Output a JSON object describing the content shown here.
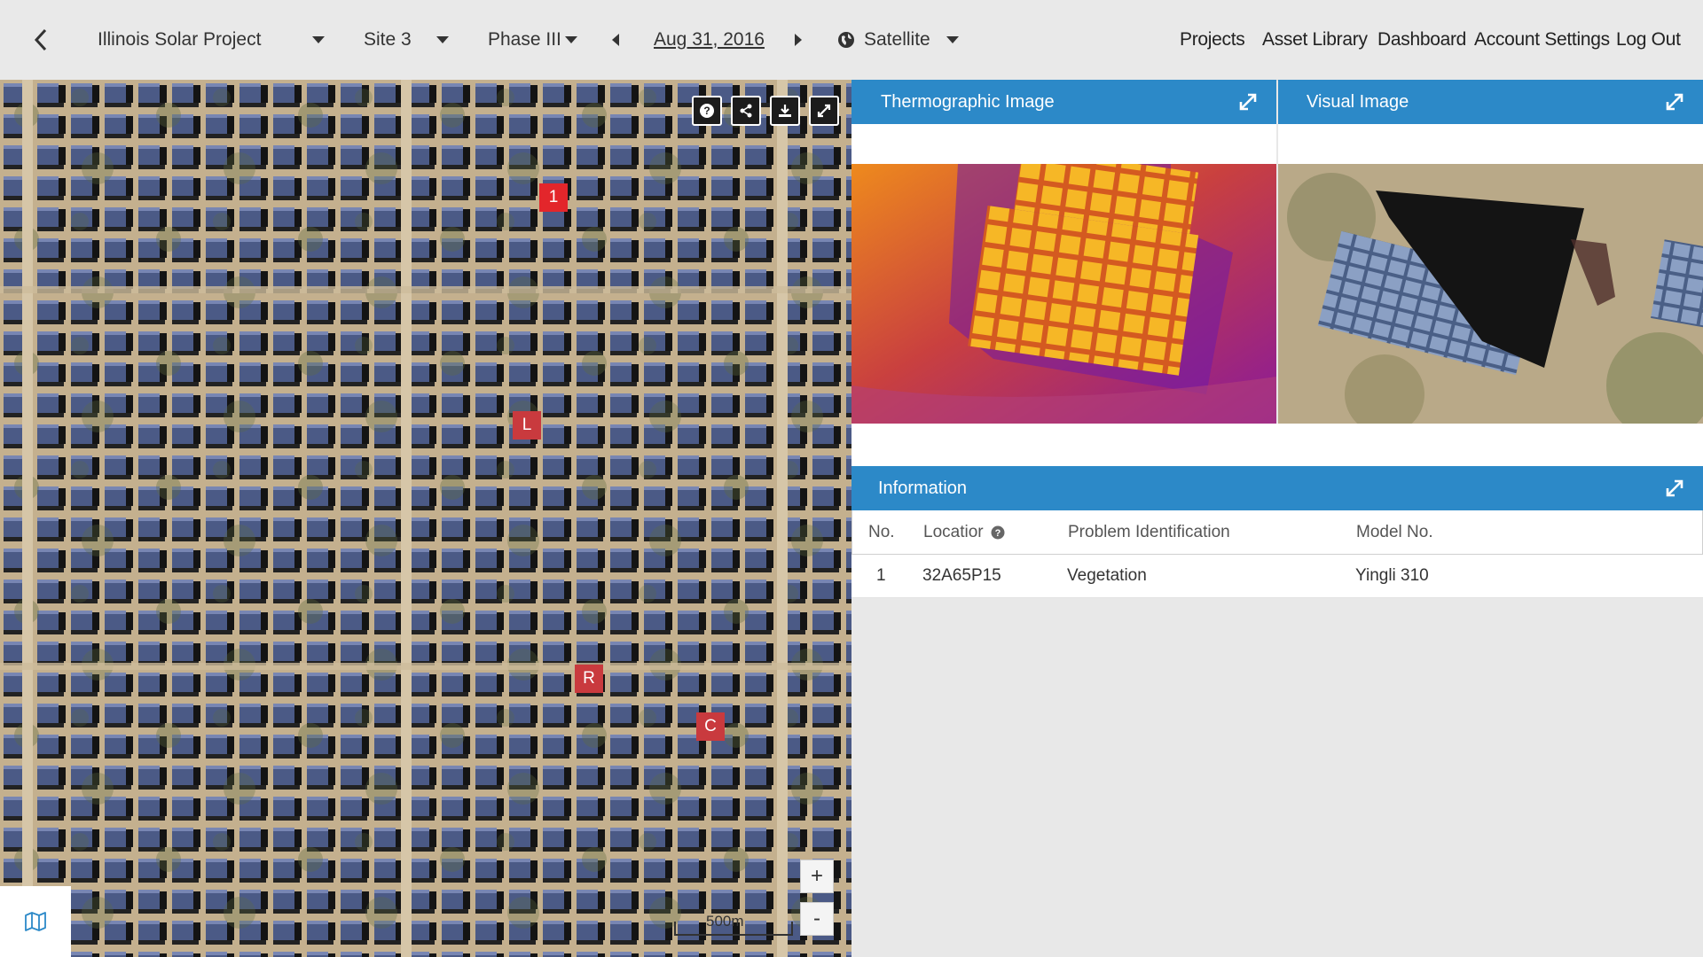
{
  "topbar": {
    "project": "Illinois Solar Project",
    "site": "Site 3",
    "phase": "Phase III",
    "date": "Aug 31, 2016",
    "view": "Satellite",
    "nav": [
      "Projects",
      "Asset Library",
      "Dashboard",
      "Account Settings",
      "Log Out"
    ]
  },
  "map": {
    "markers": [
      "1",
      "L",
      "R",
      "C"
    ],
    "zoom_in": "+",
    "zoom_out": "-",
    "scale_label": "500m"
  },
  "panels": {
    "thermo_title": "Thermographic Image",
    "visual_title": "Visual Image",
    "info_title": "Information"
  },
  "table": {
    "headers": [
      "No.",
      "Locatior",
      "Problem Identification",
      "Model No."
    ],
    "rows": [
      [
        "1",
        "32A65P15",
        "Vegetation",
        "Yingli 310"
      ]
    ]
  },
  "colors": {
    "accent": "#2c89c8",
    "marker_primary": "#e3262b",
    "marker_secondary": "#c93a3e"
  }
}
